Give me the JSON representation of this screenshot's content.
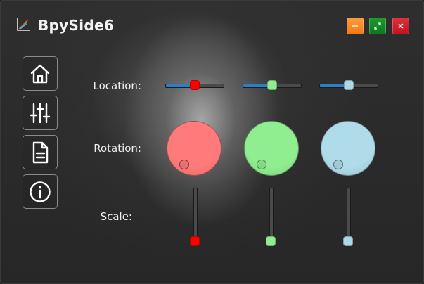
{
  "app": {
    "title": "BpySide6",
    "logo_icon": "chart-logo-icon"
  },
  "window_controls": {
    "minimize_icon": "minimize-icon",
    "maximize_icon": "maximize-icon",
    "close_icon": "close-icon",
    "colors": {
      "minimize": "#f58220",
      "maximize": "#12882a",
      "close": "#d0202a"
    }
  },
  "sidebar": {
    "items": [
      {
        "icon": "home-icon"
      },
      {
        "icon": "sliders-icon"
      },
      {
        "icon": "document-icon"
      },
      {
        "icon": "info-icon"
      }
    ]
  },
  "controls": {
    "location_label": "Location:",
    "rotation_label": "Rotation:",
    "scale_label": "Scale:",
    "channels": [
      {
        "color": "#ff0000",
        "dial_color": "#ff7a7a",
        "location_level": 0.5,
        "scale_level": 0.0
      },
      {
        "color": "#90ee90",
        "dial_color": "#90ee90",
        "location_level": 0.5,
        "scale_level": 0.0
      },
      {
        "color": "#add8e6",
        "dial_color": "#b0dcea",
        "location_level": 0.5,
        "scale_level": 0.0
      }
    ]
  }
}
